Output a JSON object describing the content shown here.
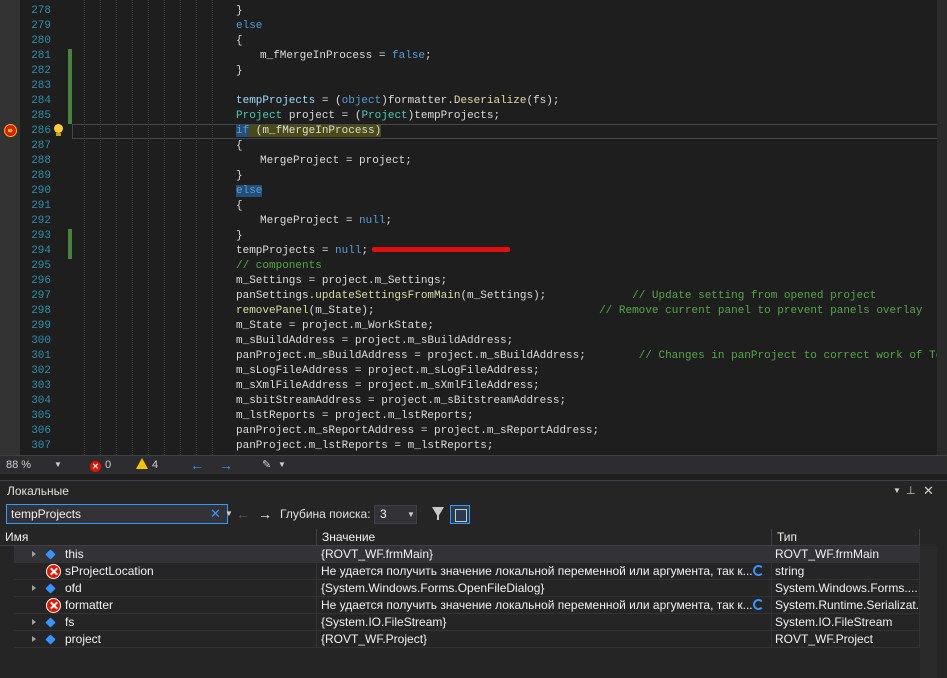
{
  "editor": {
    "lines": [
      {
        "n": "278",
        "code": [
          {
            "t": "}",
            "c": ""
          }
        ],
        "indent": 0,
        "bar": false
      },
      {
        "n": "279",
        "code": [
          {
            "t": "else",
            "c": "k"
          }
        ],
        "indent": 0,
        "bar": false
      },
      {
        "n": "280",
        "code": [
          {
            "t": "{",
            "c": ""
          }
        ],
        "indent": 0,
        "bar": false
      },
      {
        "n": "281",
        "code": [
          {
            "t": "m_fMergeInProcess",
            "c": ""
          },
          {
            "t": " = ",
            "c": ""
          },
          {
            "t": "false",
            "c": "k"
          },
          {
            "t": ";",
            "c": ""
          }
        ],
        "indent": 4,
        "bar": true
      },
      {
        "n": "282",
        "code": [
          {
            "t": "}",
            "c": ""
          }
        ],
        "indent": 0,
        "bar": true
      },
      {
        "n": "283",
        "code": [],
        "indent": 0,
        "bar": true
      },
      {
        "n": "284",
        "code": [
          {
            "t": "tempProjects",
            "c": "v"
          },
          {
            "t": " = (",
            "c": ""
          },
          {
            "t": "object",
            "c": "k"
          },
          {
            "t": ")formatter.",
            "c": ""
          },
          {
            "t": "Deserialize",
            "c": "m"
          },
          {
            "t": "(fs);",
            "c": ""
          }
        ],
        "indent": 0,
        "bar": true
      },
      {
        "n": "285",
        "code": [
          {
            "t": "Project",
            "c": "t"
          },
          {
            "t": " project = (",
            "c": ""
          },
          {
            "t": "Project",
            "c": "t"
          },
          {
            "t": ")tempProjects;",
            "c": ""
          }
        ],
        "indent": 0,
        "bar": true
      },
      {
        "n": "286",
        "code": [
          {
            "t": "if",
            "c": "kb"
          },
          {
            "t": " (m_fMergeInProcess)",
            "c": "ifhl"
          }
        ],
        "indent": 0,
        "bar": false,
        "current": true
      },
      {
        "n": "287",
        "code": [
          {
            "t": "{",
            "c": ""
          }
        ],
        "indent": 0,
        "bar": false
      },
      {
        "n": "288",
        "code": [
          {
            "t": "MergeProject",
            "c": ""
          },
          {
            "t": " = project;",
            "c": ""
          }
        ],
        "indent": 4,
        "bar": false
      },
      {
        "n": "289",
        "code": [
          {
            "t": "}",
            "c": ""
          }
        ],
        "indent": 0,
        "bar": false
      },
      {
        "n": "290",
        "code": [
          {
            "t": "else",
            "c": "kb"
          }
        ],
        "indent": 0,
        "bar": false
      },
      {
        "n": "291",
        "code": [
          {
            "t": "{",
            "c": ""
          }
        ],
        "indent": 0,
        "bar": false
      },
      {
        "n": "292",
        "code": [
          {
            "t": "MergeProject",
            "c": ""
          },
          {
            "t": " = ",
            "c": ""
          },
          {
            "t": "null",
            "c": "k"
          },
          {
            "t": ";",
            "c": ""
          }
        ],
        "indent": 4,
        "bar": false
      },
      {
        "n": "293",
        "code": [
          {
            "t": "}",
            "c": ""
          }
        ],
        "indent": 0,
        "bar": true
      },
      {
        "n": "294",
        "code": [
          {
            "t": "tempProjects",
            "c": ""
          },
          {
            "t": " = ",
            "c": ""
          },
          {
            "t": "null",
            "c": "k"
          },
          {
            "t": ";",
            "c": ""
          }
        ],
        "indent": 0,
        "bar": true
      },
      {
        "n": "295",
        "code": [
          {
            "t": "// components",
            "c": "c"
          }
        ],
        "indent": 0,
        "bar": false
      },
      {
        "n": "296",
        "code": [
          {
            "t": "m_Settings = project.m_Settings;",
            "c": ""
          }
        ],
        "indent": 0,
        "bar": false
      },
      {
        "n": "297",
        "code": [
          {
            "t": "panSettings.",
            "c": ""
          },
          {
            "t": "updateSettingsFromMain",
            "c": "m"
          },
          {
            "t": "(m_Settings);             ",
            "c": ""
          },
          {
            "t": "// Update setting from opened project",
            "c": "c"
          }
        ],
        "indent": 0,
        "bar": false
      },
      {
        "n": "298",
        "code": [
          {
            "t": "removePanel",
            "c": "m"
          },
          {
            "t": "(m_State);                                  ",
            "c": ""
          },
          {
            "t": "// Remove current panel to prevent panels overlay",
            "c": "c"
          }
        ],
        "indent": 0,
        "bar": false
      },
      {
        "n": "299",
        "code": [
          {
            "t": "m_State = project.m_WorkState;",
            "c": ""
          }
        ],
        "indent": 0,
        "bar": false
      },
      {
        "n": "300",
        "code": [
          {
            "t": "m_sBuildAddress = project.m_sBuildAddress;",
            "c": ""
          }
        ],
        "indent": 0,
        "bar": false
      },
      {
        "n": "301",
        "code": [
          {
            "t": "panProject.m_sBuildAddress = project.m_sBuildAddress;        ",
            "c": ""
          },
          {
            "t": "// Changes in panProject to correct work of ToLibSet",
            "c": "c"
          }
        ],
        "indent": 0,
        "bar": false
      },
      {
        "n": "302",
        "code": [
          {
            "t": "m_sLogFileAddress = project.m_sLogFileAddress;",
            "c": ""
          }
        ],
        "indent": 0,
        "bar": false
      },
      {
        "n": "303",
        "code": [
          {
            "t": "m_sXmlFileAddress = project.m_sXmlFileAddress;",
            "c": ""
          }
        ],
        "indent": 0,
        "bar": false
      },
      {
        "n": "304",
        "code": [
          {
            "t": "m_sbitStreamAddress = project.m_sBitstreamAddress;",
            "c": ""
          }
        ],
        "indent": 0,
        "bar": false
      },
      {
        "n": "305",
        "code": [
          {
            "t": "m_lstReports = project.m_lstReports;",
            "c": ""
          }
        ],
        "indent": 0,
        "bar": false
      },
      {
        "n": "306",
        "code": [
          {
            "t": "panProject.m_sReportAddress = project.m_sReportAddress;",
            "c": ""
          }
        ],
        "indent": 0,
        "bar": false
      },
      {
        "n": "307",
        "code": [
          {
            "t": "panProject.m_lstReports = m_lstReports;",
            "c": ""
          }
        ],
        "indent": 0,
        "bar": false
      }
    ]
  },
  "statusbar": {
    "zoom": "88 %",
    "errors": "0",
    "warnings": "4"
  },
  "locals": {
    "title": "Локальные",
    "search_value": "tempProjects",
    "depth_label": "Глубина поиска:",
    "depth_value": "3",
    "columns": {
      "name": "Имя",
      "value": "Значение",
      "type": "Тип"
    },
    "rows": [
      {
        "name": "this",
        "value": "{ROVT_WF.frmMain}",
        "type": "ROVT_WF.frmMain",
        "icon": "cube-icon",
        "expandable": true,
        "refresh": false
      },
      {
        "name": "sProjectLocation",
        "value": "Не удается получить значение локальной переменной или аргумента, так к...",
        "type": "string",
        "icon": "error-icon",
        "expandable": false,
        "refresh": true
      },
      {
        "name": "ofd",
        "value": "{System.Windows.Forms.OpenFileDialog}",
        "type": "System.Windows.Forms....",
        "icon": "cube-icon",
        "expandable": true,
        "refresh": false
      },
      {
        "name": "formatter",
        "value": "Не удается получить значение локальной переменной или аргумента, так к...",
        "type": "System.Runtime.Serializat...",
        "icon": "error-icon",
        "expandable": false,
        "refresh": true
      },
      {
        "name": "fs",
        "value": "{System.IO.FileStream}",
        "type": "System.IO.FileStream",
        "icon": "cube-icon",
        "expandable": true,
        "refresh": false
      },
      {
        "name": "project",
        "value": "{ROVT_WF.Project}",
        "type": "ROVT_WF.Project",
        "icon": "cube-icon",
        "expandable": true,
        "refresh": false
      }
    ]
  },
  "colors": {
    "editor_bg": "#1e1e1e",
    "keyword": "#569cd6",
    "type": "#4ec9b0",
    "method": "#dcdcaa",
    "comment": "#57a64a",
    "line_number": "#2b91af",
    "accent": "#3399ff",
    "error": "#e51400"
  }
}
